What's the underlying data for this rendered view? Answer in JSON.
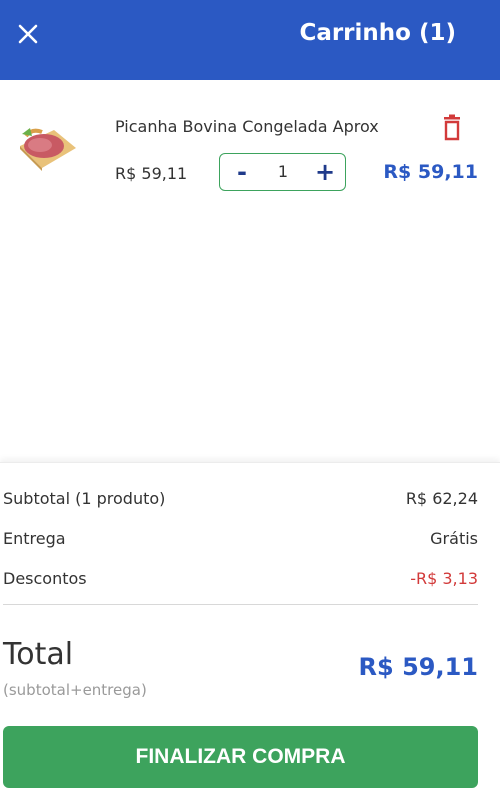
{
  "header": {
    "title": "Carrinho (1)",
    "close_icon": "close-icon",
    "background": "#2b59c3"
  },
  "cart": {
    "items": [
      {
        "name": "Picanha Bovina Congelada Aprox",
        "unit_price": "R$ 59,11",
        "quantity": "1",
        "line_total": "R$ 59,11",
        "image_icon": "meat-product-image",
        "delete_icon": "trash-icon",
        "decrement_label": "-",
        "increment_label": "+"
      }
    ]
  },
  "summary": {
    "subtotal_label": "Subtotal (1 produto)",
    "subtotal_value": "R$ 62,24",
    "delivery_label": "Entrega",
    "delivery_value": "Grátis",
    "discount_label": "Descontos",
    "discount_value": "-R$ 3,13",
    "total_label": "Total",
    "total_note": "(subtotal+entrega)",
    "total_value": "R$ 59,11",
    "checkout_label": "FINALIZAR COMPRA"
  },
  "colors": {
    "primary": "#2b59c3",
    "success": "#3da35d",
    "danger": "#d23a3a"
  }
}
